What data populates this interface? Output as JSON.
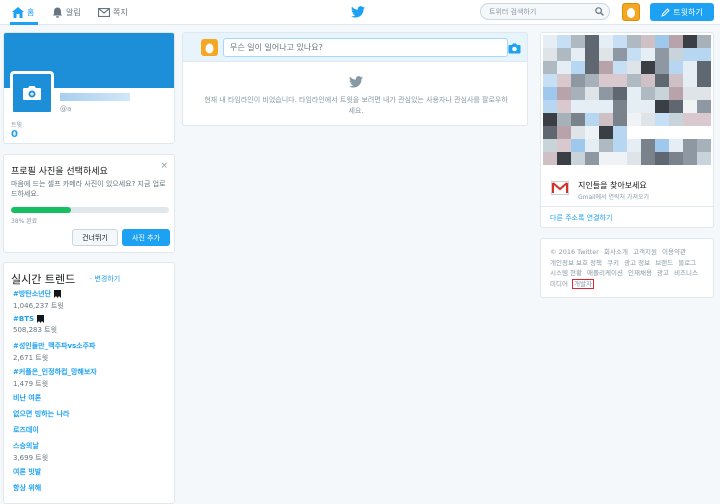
{
  "nav": {
    "home": "홈",
    "alerts": "알림",
    "messages": "쪽지",
    "search_placeholder": "트위터 검색하기",
    "tweet_button": "트윗하기"
  },
  "profile": {
    "handle": "@a",
    "tweets_label": "트윗",
    "tweets_count": "0"
  },
  "photo_prompt": {
    "title": "프로필 사진을 선택하세요",
    "close": "×",
    "description": "마음에 드는 셀프 카메라 사진이 있으세요? 지금 업로드하세요.",
    "progress_percent": 38,
    "progress_label": "38% 완료",
    "skip_button": "건너뛰기",
    "add_button": "사진 추가"
  },
  "trends": {
    "title": "실시간 트렌드",
    "change_link": "· 변경하기",
    "items": [
      {
        "name": "#방탄소년단",
        "count": "1,046,237 트윗",
        "icon": true
      },
      {
        "name": "#BTS",
        "count": "508,283 트윗",
        "icon": true
      },
      {
        "name": "#성인들만_맥주파vs소주파",
        "count": "2,671 트윗",
        "icon": false
      },
      {
        "name": "#커플은_인정하컵_망해보자",
        "count": "1,479 트윗",
        "icon": false
      },
      {
        "name": "비난 여론",
        "count": "",
        "icon": false
      },
      {
        "name": "없으면 빙하는 나라",
        "count": "",
        "icon": false
      },
      {
        "name": "로즈데이",
        "count": "",
        "icon": false
      },
      {
        "name": "스승의날",
        "count": "3,699 트윗",
        "icon": false
      },
      {
        "name": "여론 빗발",
        "count": "",
        "icon": false
      },
      {
        "name": "항상 위해",
        "count": "",
        "icon": false
      }
    ]
  },
  "compose": {
    "placeholder": "무슨 일이 일어나고 있나요?"
  },
  "timeline": {
    "empty_text": "현재 내 타임라인이 비었습니다. 타임라인에서 트윗을 보려면 내가 관심있는 사용자나 관심사를 팔로우하세요."
  },
  "find_friends": {
    "title": "지인들을 찾아보세요",
    "subtitle": "Gmail에서 연락처 가져오기",
    "connect_link": "다른 주소록 연결하기"
  },
  "footer": {
    "links": [
      "© 2016 Twitter",
      "회사소개",
      "고객지원",
      "이용약관",
      "개인정보 보호 정책",
      "쿠키",
      "광고 정보",
      "브랜드",
      "블로그",
      "시스템 현황",
      "애플리케이션",
      "인재채용",
      "광고",
      "비즈니스",
      "미디어"
    ],
    "developer": "개발자"
  },
  "colors": {
    "accent": "#1da1f2",
    "banner": "#1d8fd8",
    "egg": "#f5a623",
    "progress": "#17bf63",
    "highlight": "#e0262b"
  }
}
